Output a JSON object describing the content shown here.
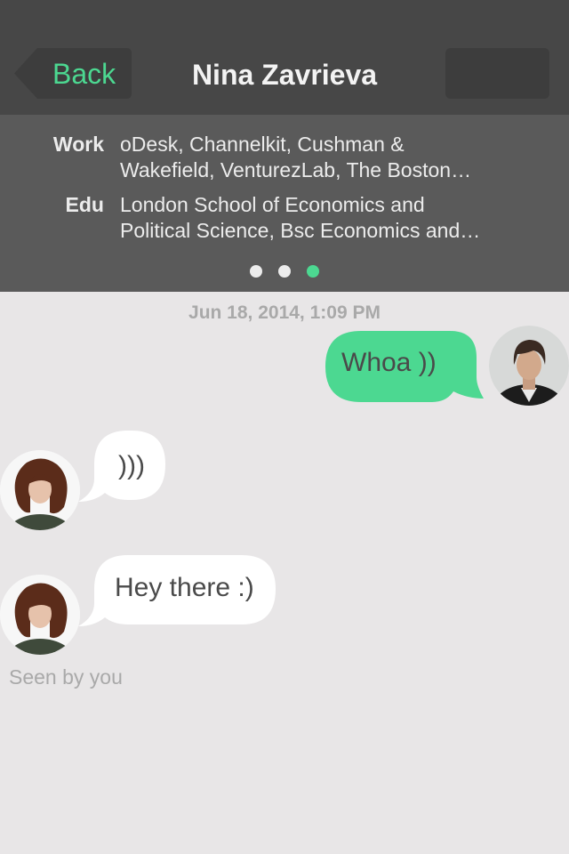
{
  "header": {
    "back_label": "Back",
    "title": "Nina Zavrieva",
    "accent_color": "#4cd891"
  },
  "profile": {
    "work": {
      "label": "Work",
      "lines": [
        "oDesk, Channelkit, Cushman &",
        "Wakefield, VenturezLab, The Boston…"
      ]
    },
    "edu": {
      "label": "Edu",
      "lines": [
        "London School of Economics and",
        "Political Science, Bsc Economics and…"
      ]
    },
    "pager": {
      "count": 3,
      "active_index": 2
    }
  },
  "conversation": {
    "timestamp": "Jun 18, 2014, 1:09 PM",
    "messages": [
      {
        "sender": "me",
        "text": "Whoa ))",
        "avatar_icon": "user-avatar-icon"
      },
      {
        "sender": "Nina Zavrieva",
        "text": ")))",
        "avatar_icon": "contact-avatar-icon"
      },
      {
        "sender": "Nina Zavrieva",
        "text": "Hey there :)",
        "avatar_icon": "contact-avatar-icon"
      }
    ],
    "seen_status": "Seen by you"
  },
  "colors": {
    "outgoing_bubble": "#4cd891",
    "incoming_bubble": "#ffffff",
    "background": "#e8e6e7"
  }
}
